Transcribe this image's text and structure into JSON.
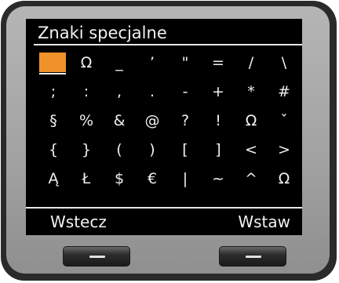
{
  "screen": {
    "title": "Znaki specjalne"
  },
  "grid": {
    "rows": [
      [
        " ",
        "Ω",
        "_",
        "’",
        "\"",
        "=",
        "/",
        "\\"
      ],
      [
        ";",
        ":",
        ",",
        ".",
        "-",
        "+",
        "*",
        "#"
      ],
      [
        "§",
        "%",
        "&",
        "@",
        "?",
        "!",
        "Ω",
        "ˇ"
      ],
      [
        "{",
        "}",
        "(",
        ")",
        "[",
        "]",
        "<",
        ">"
      ],
      [
        "Ą",
        "Ł",
        "$",
        "€",
        "|",
        "~",
        "^",
        "Ω"
      ]
    ],
    "selected_index": "0,0"
  },
  "softkeys": {
    "left": "Wstecz",
    "right": "Wstaw"
  },
  "colors": {
    "selection": "#f0922b",
    "screen_bg": "#000000",
    "text": "#f2f2f2"
  }
}
